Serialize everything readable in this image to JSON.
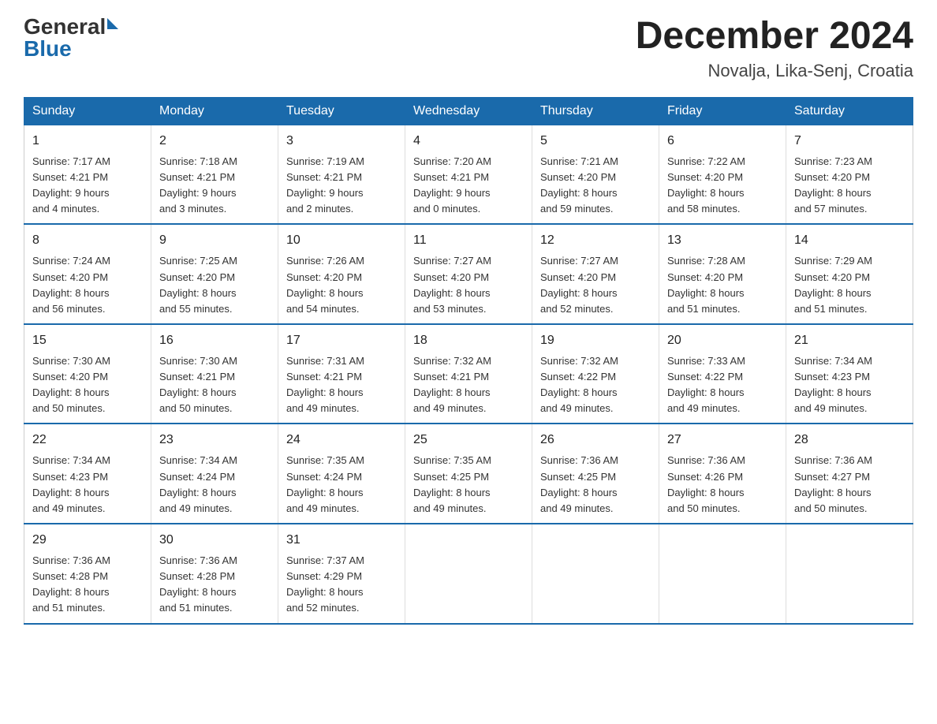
{
  "header": {
    "logo_general": "General",
    "logo_blue": "Blue",
    "month_title": "December 2024",
    "location": "Novalja, Lika-Senj, Croatia"
  },
  "days_of_week": [
    "Sunday",
    "Monday",
    "Tuesday",
    "Wednesday",
    "Thursday",
    "Friday",
    "Saturday"
  ],
  "weeks": [
    [
      {
        "date": "1",
        "sunrise": "7:17 AM",
        "sunset": "4:21 PM",
        "daylight": "9 hours and 4 minutes."
      },
      {
        "date": "2",
        "sunrise": "7:18 AM",
        "sunset": "4:21 PM",
        "daylight": "9 hours and 3 minutes."
      },
      {
        "date": "3",
        "sunrise": "7:19 AM",
        "sunset": "4:21 PM",
        "daylight": "9 hours and 2 minutes."
      },
      {
        "date": "4",
        "sunrise": "7:20 AM",
        "sunset": "4:21 PM",
        "daylight": "9 hours and 0 minutes."
      },
      {
        "date": "5",
        "sunrise": "7:21 AM",
        "sunset": "4:20 PM",
        "daylight": "8 hours and 59 minutes."
      },
      {
        "date": "6",
        "sunrise": "7:22 AM",
        "sunset": "4:20 PM",
        "daylight": "8 hours and 58 minutes."
      },
      {
        "date": "7",
        "sunrise": "7:23 AM",
        "sunset": "4:20 PM",
        "daylight": "8 hours and 57 minutes."
      }
    ],
    [
      {
        "date": "8",
        "sunrise": "7:24 AM",
        "sunset": "4:20 PM",
        "daylight": "8 hours and 56 minutes."
      },
      {
        "date": "9",
        "sunrise": "7:25 AM",
        "sunset": "4:20 PM",
        "daylight": "8 hours and 55 minutes."
      },
      {
        "date": "10",
        "sunrise": "7:26 AM",
        "sunset": "4:20 PM",
        "daylight": "8 hours and 54 minutes."
      },
      {
        "date": "11",
        "sunrise": "7:27 AM",
        "sunset": "4:20 PM",
        "daylight": "8 hours and 53 minutes."
      },
      {
        "date": "12",
        "sunrise": "7:27 AM",
        "sunset": "4:20 PM",
        "daylight": "8 hours and 52 minutes."
      },
      {
        "date": "13",
        "sunrise": "7:28 AM",
        "sunset": "4:20 PM",
        "daylight": "8 hours and 51 minutes."
      },
      {
        "date": "14",
        "sunrise": "7:29 AM",
        "sunset": "4:20 PM",
        "daylight": "8 hours and 51 minutes."
      }
    ],
    [
      {
        "date": "15",
        "sunrise": "7:30 AM",
        "sunset": "4:20 PM",
        "daylight": "8 hours and 50 minutes."
      },
      {
        "date": "16",
        "sunrise": "7:30 AM",
        "sunset": "4:21 PM",
        "daylight": "8 hours and 50 minutes."
      },
      {
        "date": "17",
        "sunrise": "7:31 AM",
        "sunset": "4:21 PM",
        "daylight": "8 hours and 49 minutes."
      },
      {
        "date": "18",
        "sunrise": "7:32 AM",
        "sunset": "4:21 PM",
        "daylight": "8 hours and 49 minutes."
      },
      {
        "date": "19",
        "sunrise": "7:32 AM",
        "sunset": "4:22 PM",
        "daylight": "8 hours and 49 minutes."
      },
      {
        "date": "20",
        "sunrise": "7:33 AM",
        "sunset": "4:22 PM",
        "daylight": "8 hours and 49 minutes."
      },
      {
        "date": "21",
        "sunrise": "7:34 AM",
        "sunset": "4:23 PM",
        "daylight": "8 hours and 49 minutes."
      }
    ],
    [
      {
        "date": "22",
        "sunrise": "7:34 AM",
        "sunset": "4:23 PM",
        "daylight": "8 hours and 49 minutes."
      },
      {
        "date": "23",
        "sunrise": "7:34 AM",
        "sunset": "4:24 PM",
        "daylight": "8 hours and 49 minutes."
      },
      {
        "date": "24",
        "sunrise": "7:35 AM",
        "sunset": "4:24 PM",
        "daylight": "8 hours and 49 minutes."
      },
      {
        "date": "25",
        "sunrise": "7:35 AM",
        "sunset": "4:25 PM",
        "daylight": "8 hours and 49 minutes."
      },
      {
        "date": "26",
        "sunrise": "7:36 AM",
        "sunset": "4:25 PM",
        "daylight": "8 hours and 49 minutes."
      },
      {
        "date": "27",
        "sunrise": "7:36 AM",
        "sunset": "4:26 PM",
        "daylight": "8 hours and 50 minutes."
      },
      {
        "date": "28",
        "sunrise": "7:36 AM",
        "sunset": "4:27 PM",
        "daylight": "8 hours and 50 minutes."
      }
    ],
    [
      {
        "date": "29",
        "sunrise": "7:36 AM",
        "sunset": "4:28 PM",
        "daylight": "8 hours and 51 minutes."
      },
      {
        "date": "30",
        "sunrise": "7:36 AM",
        "sunset": "4:28 PM",
        "daylight": "8 hours and 51 minutes."
      },
      {
        "date": "31",
        "sunrise": "7:37 AM",
        "sunset": "4:29 PM",
        "daylight": "8 hours and 52 minutes."
      },
      null,
      null,
      null,
      null
    ]
  ],
  "labels": {
    "sunrise": "Sunrise:",
    "sunset": "Sunset:",
    "daylight": "Daylight:"
  }
}
